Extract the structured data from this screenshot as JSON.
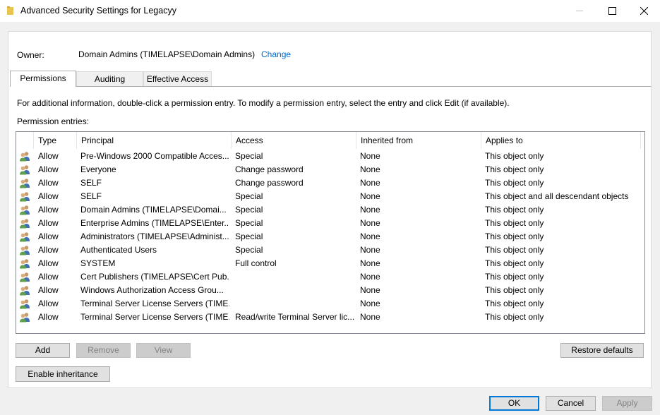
{
  "window": {
    "title": "Advanced Security Settings for Legacyy"
  },
  "owner": {
    "label": "Owner:",
    "value": "Domain Admins (TIMELAPSE\\Domain Admins)",
    "change_link": "Change"
  },
  "tabs": [
    {
      "label": "Permissions",
      "active": true
    },
    {
      "label": "Auditing",
      "active": false
    },
    {
      "label": "Effective Access",
      "active": false
    }
  ],
  "info_text": "For additional information, double-click a permission entry. To modify a permission entry, select the entry and click Edit (if available).",
  "entries_label": "Permission entries:",
  "columns": [
    "Type",
    "Principal",
    "Access",
    "Inherited from",
    "Applies to"
  ],
  "entries": [
    {
      "type": "Allow",
      "principal": "Pre-Windows 2000 Compatible Acces...",
      "access": "Special",
      "inherited": "None",
      "applies": "This object only"
    },
    {
      "type": "Allow",
      "principal": "Everyone",
      "access": "Change password",
      "inherited": "None",
      "applies": "This object only"
    },
    {
      "type": "Allow",
      "principal": "SELF",
      "access": "Change password",
      "inherited": "None",
      "applies": "This object only"
    },
    {
      "type": "Allow",
      "principal": "SELF",
      "access": "Special",
      "inherited": "None",
      "applies": "This object and all descendant objects"
    },
    {
      "type": "Allow",
      "principal": "Domain Admins (TIMELAPSE\\Domai...",
      "access": "Special",
      "inherited": "None",
      "applies": "This object only"
    },
    {
      "type": "Allow",
      "principal": "Enterprise Admins (TIMELAPSE\\Enter...",
      "access": "Special",
      "inherited": "None",
      "applies": "This object only"
    },
    {
      "type": "Allow",
      "principal": "Administrators (TIMELAPSE\\Administ...",
      "access": "Special",
      "inherited": "None",
      "applies": "This object only"
    },
    {
      "type": "Allow",
      "principal": "Authenticated Users",
      "access": "Special",
      "inherited": "None",
      "applies": "This object only"
    },
    {
      "type": "Allow",
      "principal": "SYSTEM",
      "access": "Full control",
      "inherited": "None",
      "applies": "This object only"
    },
    {
      "type": "Allow",
      "principal": "Cert Publishers (TIMELAPSE\\Cert Pub...",
      "access": "",
      "inherited": "None",
      "applies": "This object only"
    },
    {
      "type": "Allow",
      "principal": "Windows Authorization Access Grou...",
      "access": "",
      "inherited": "None",
      "applies": "This object only"
    },
    {
      "type": "Allow",
      "principal": "Terminal Server License Servers (TIME...",
      "access": "",
      "inherited": "None",
      "applies": "This object only"
    },
    {
      "type": "Allow",
      "principal": "Terminal Server License Servers (TIME...",
      "access": "Read/write Terminal Server lic...",
      "inherited": "None",
      "applies": "This object only"
    }
  ],
  "buttons": {
    "add": "Add",
    "remove": "Remove",
    "view": "View",
    "restore_defaults": "Restore defaults",
    "enable_inheritance": "Enable inheritance",
    "ok": "OK",
    "cancel": "Cancel",
    "apply": "Apply"
  },
  "icons": {
    "title": "folder-icon",
    "entry": "user-group-icon",
    "minimize": "minimize-icon",
    "maximize": "maximize-icon",
    "close": "close-icon"
  },
  "colors": {
    "link": "#0066cc",
    "default_button_border": "#0078d7",
    "folder": "#e8c54d"
  }
}
